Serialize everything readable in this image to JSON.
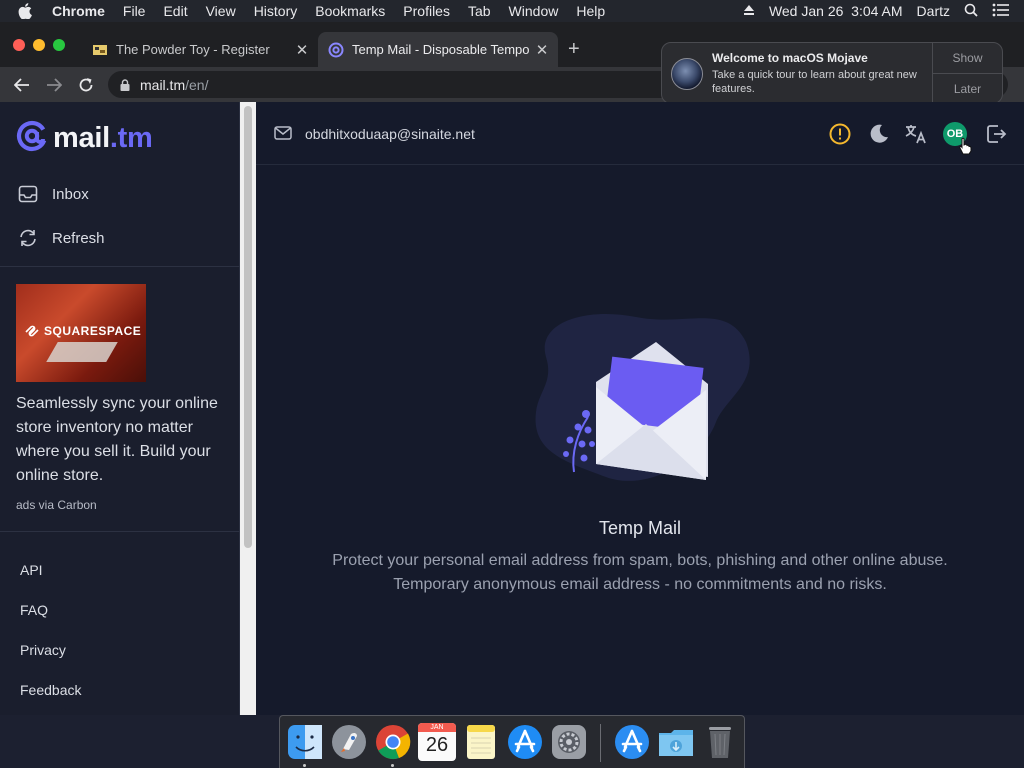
{
  "menubar": {
    "app_name": "Chrome",
    "items": [
      "File",
      "Edit",
      "View",
      "History",
      "Bookmarks",
      "Profiles",
      "Tab",
      "Window",
      "Help"
    ],
    "datetime": "Wed Jan 26  3:04 AM",
    "user": "Dartz"
  },
  "tabs": [
    {
      "title": "The Powder Toy - Register"
    },
    {
      "title": "Temp Mail - Disposable Tempo"
    }
  ],
  "address": {
    "host": "mail.tm",
    "path": "/en/"
  },
  "notification": {
    "title": "Welcome to macOS Mojave",
    "body": "Take a quick tour to learn about great new features.",
    "show_label": "Show",
    "later_label": "Later"
  },
  "sidebar": {
    "logo_main": "mail",
    "logo_accent": ".tm",
    "nav": [
      {
        "label": "Inbox",
        "icon": "inbox-icon"
      },
      {
        "label": "Refresh",
        "icon": "refresh-icon"
      }
    ],
    "ad": {
      "brand": "SQUARESPACE",
      "copy": "Seamlessly sync your online store inventory no matter where you sell it. Build your online store.",
      "via": "ads via Carbon"
    },
    "footer_links": [
      "API",
      "FAQ",
      "Privacy",
      "Feedback"
    ]
  },
  "main": {
    "email": "obdhitxoduaap@sinaite.net",
    "avatar_initials": "OB",
    "empty_title": "Temp Mail",
    "empty_line1": "Protect your personal email address from spam, bots, phishing and other online abuse.",
    "empty_line2": "Temporary anonymous email address - no commitments and no risks."
  },
  "colors": {
    "accent": "#6b69f5",
    "warning": "#f5b82e",
    "avatar": "#0e9a6b"
  },
  "dock": [
    "finder",
    "launchpad",
    "chrome",
    "calendar",
    "notes",
    "app-store",
    "system-preferences",
    "app-store-2",
    "downloads-folder",
    "trash"
  ],
  "calendar_icon": {
    "month": "JAN",
    "day": "26"
  }
}
